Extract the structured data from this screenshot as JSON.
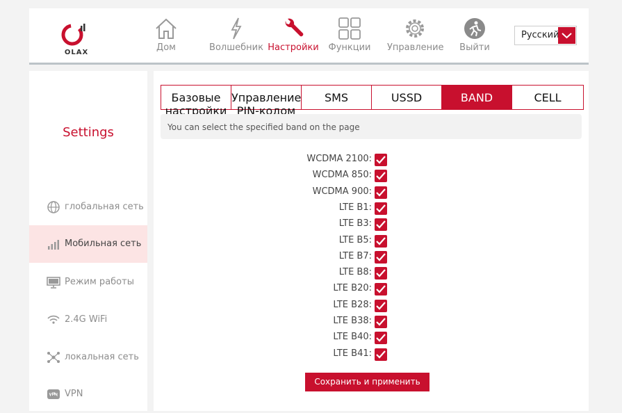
{
  "brand": {
    "name": "OLAX",
    "accent": "#c8102e"
  },
  "nav": [
    {
      "label": "Дом",
      "icon": "home-icon"
    },
    {
      "label": "Волшебник",
      "icon": "wizard-bolt-icon"
    },
    {
      "label": "Настройки",
      "icon": "wrench-icon",
      "active": true
    },
    {
      "label": "Функции",
      "icon": "grid-icon"
    },
    {
      "label": "Управление",
      "icon": "gear-icon"
    },
    {
      "label": "Выйти",
      "icon": "logout-runner-icon"
    }
  ],
  "language": {
    "selected": "Русский"
  },
  "sidebar": {
    "title": "Settings",
    "items": [
      {
        "label": "глобальная сеть",
        "icon": "globe-icon"
      },
      {
        "label": "Мобильная сеть",
        "icon": "signal-bars-icon",
        "active": true
      },
      {
        "label": "Режим работы",
        "icon": "monitor-icon"
      },
      {
        "label": "2.4G WiFi",
        "icon": "wifi-icon"
      },
      {
        "label": "локальная сеть",
        "icon": "lan-network-icon"
      },
      {
        "label": "VPN",
        "icon": "vpn-icon"
      }
    ]
  },
  "tabs": [
    {
      "label": "Базовые настройки"
    },
    {
      "label": "Управление PIN-кодом"
    },
    {
      "label": "SMS"
    },
    {
      "label": "USSD"
    },
    {
      "label": "BAND",
      "active": true
    },
    {
      "label": "CELL"
    }
  ],
  "notice": "You can select the specified band on the page",
  "bands": [
    {
      "label": "WCDMA 2100:",
      "checked": true
    },
    {
      "label": "WCDMA 850:",
      "checked": true
    },
    {
      "label": "WCDMA 900:",
      "checked": true
    },
    {
      "label": "LTE B1:",
      "checked": true
    },
    {
      "label": "LTE B3:",
      "checked": true
    },
    {
      "label": "LTE B5:",
      "checked": true
    },
    {
      "label": "LTE B7:",
      "checked": true
    },
    {
      "label": "LTE B8:",
      "checked": true
    },
    {
      "label": "LTE B20:",
      "checked": true
    },
    {
      "label": "LTE B28:",
      "checked": true
    },
    {
      "label": "LTE B38:",
      "checked": true
    },
    {
      "label": "LTE B40:",
      "checked": true
    },
    {
      "label": "LTE B41:",
      "checked": true
    }
  ],
  "save_label": "Сохранить и применить"
}
